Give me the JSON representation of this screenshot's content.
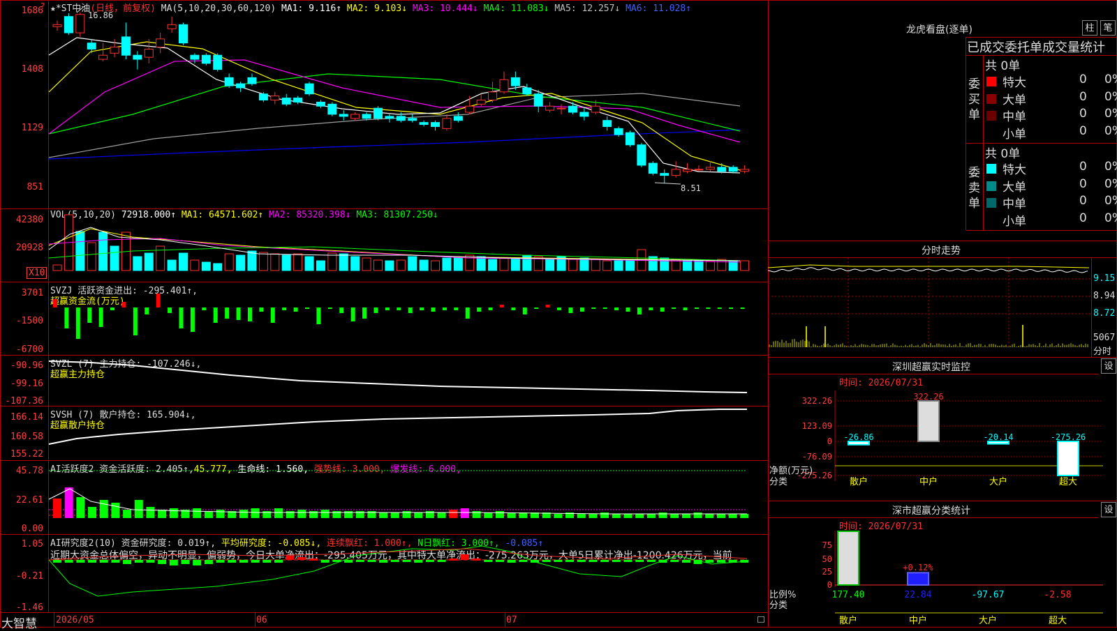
{
  "price_panel": {
    "title": "★*ST中油",
    "period": "(日线，前复权)",
    "ma_title": "MA(5,10,20,30,60,120)",
    "ma1": "MA1: 9.116↑",
    "ma2": "MA2: 9.103↓",
    "ma3": "MA3: 10.444↓",
    "ma4": "MA4: 11.083↓",
    "ma5": "MA5: 12.257↓",
    "ma6": "MA6: 11.028↑",
    "y_ticks": [
      "1686",
      "1408",
      "1129",
      "851"
    ],
    "high_label": "16.86",
    "low_label": "8.51",
    "colors": {
      "ma1": "#ffffff",
      "ma2": "#ffff00",
      "ma3": "#ff00ff",
      "ma4": "#00ff00",
      "ma5": "#a0a0a0",
      "ma6": "#0000ff",
      "up": "#ff3030",
      "down": "#00ffff"
    }
  },
  "vol_panel": {
    "title": "VOL(5,10,20)",
    "val": "72918.000↑",
    "ma1": "MA1: 64571.602↑",
    "ma2": "MA2: 85320.398↓",
    "ma3": "MA3: 81307.250↓",
    "y_ticks": [
      "42380",
      "20928"
    ],
    "unit": "X10"
  },
  "svzj_panel": {
    "title": "SVZJ  活跃资金进出: -295.401↑,",
    "sub": "超赢资金流(万元)",
    "y_ticks": [
      "3701",
      "-1500",
      "-6700"
    ]
  },
  "svzl_panel": {
    "title": "SVZL (7) 主力持仓: -107.246↓,",
    "sub": "超赢主力持仓",
    "y_ticks": [
      "-90.96",
      "-99.16",
      "-107.36"
    ]
  },
  "svsh_panel": {
    "title": "SVSH (7) 散户持仓: 165.904↓,",
    "sub": "超赢散户持仓",
    "y_ticks": [
      "166.14",
      "160.58",
      "155.22"
    ]
  },
  "ai_active_panel": {
    "title": "AI活跃度2 资金活跃度: 2.405↑,",
    "v2": "45.777,",
    "v3": "生命线: 1.560,",
    "v4": "强势线: 3.000,",
    "v5": "爆发线: 6.000,",
    "y_ticks": [
      "45.78",
      "22.61",
      "0.00"
    ]
  },
  "ai_research_panel": {
    "title": "AI研究度2(10) 资金研究度: 0.019↑,",
    "v2": "平均研究度: -0.085↓,",
    "v3": "连续飘红: 1.000↑,",
    "v4": "N日飘红: 3.000↑,",
    "v5": "-0.085↑",
    "summary": "近期大资金总体偏空，异动不明显，偏弱势，今日大单净流出：-295.405万元，其中特大单净流出：-275.263万元，大单5日累计净出-1200.426万元，当前",
    "y_ticks": [
      "1.05",
      "-0.21",
      "-1.46"
    ]
  },
  "x_axis": {
    "labels": [
      "2026/05",
      "06",
      "07"
    ],
    "brand": "大智慧"
  },
  "dragon_panel": {
    "title": "龙虎看盘(逐单)",
    "btn1": "柱",
    "btn2": "笔",
    "tabs": [
      "已成交",
      "委托单",
      "成交量统计"
    ],
    "buy_label": "委买单",
    "sell_label": "委卖单",
    "buy_total": "共 0单",
    "sell_total": "共 0单",
    "buy_rows": [
      {
        "name": "特大",
        "count": "0",
        "pct": "0%",
        "color": "#ff0000"
      },
      {
        "name": "大单",
        "count": "0",
        "pct": "0%",
        "color": "#8b0000"
      },
      {
        "name": "中单",
        "count": "0",
        "pct": "0%",
        "color": "#6a0000"
      },
      {
        "name": "小单",
        "count": "0",
        "pct": "0%",
        "color": "#000000"
      }
    ],
    "sell_rows": [
      {
        "name": "特大",
        "count": "0",
        "pct": "0%",
        "color": "#00ffff"
      },
      {
        "name": "大单",
        "count": "0",
        "pct": "0%",
        "color": "#008b8b"
      },
      {
        "name": "中单",
        "count": "0",
        "pct": "0%",
        "color": "#006a6a"
      },
      {
        "name": "小单",
        "count": "0",
        "pct": "0%",
        "color": "#000000"
      }
    ]
  },
  "intraday_panel": {
    "title": "分时走势",
    "y_ticks": [
      "9.15",
      "8.94",
      "8.72"
    ],
    "vol_tick": "5067",
    "vol_label": "分时"
  },
  "sz_monitor": {
    "title": "深圳超赢实时监控",
    "btn": "设",
    "time": "时间: 2026/07/31",
    "y_ticks": [
      "322.26",
      "123.09",
      "0",
      "-76.09",
      "-275.26"
    ],
    "ylabel1": "净额(万元)",
    "ylabel2": "分类",
    "categories": [
      "散户",
      "中户",
      "大户",
      "超大"
    ],
    "values": [
      -26.86,
      322.26,
      -20.14,
      -275.26
    ],
    "value_labels": [
      "-26.86",
      "322.26",
      "-20.14",
      "-275.26"
    ]
  },
  "sz_stats": {
    "title": "深市超赢分类统计",
    "btn": "设",
    "time": "时间: 2026/07/31",
    "y_ticks": [
      "75",
      "50",
      "25",
      "0"
    ],
    "ylabel1": "比例%",
    "ylabel2": "分类",
    "categories": [
      "散户",
      "中户",
      "大户",
      "超大"
    ],
    "bottom_values": [
      "177.40",
      "22.84",
      "-97.67",
      "-2.58"
    ],
    "mid_label": "+0.12%",
    "pct": [
      100,
      22.84,
      0,
      0
    ]
  }
}
